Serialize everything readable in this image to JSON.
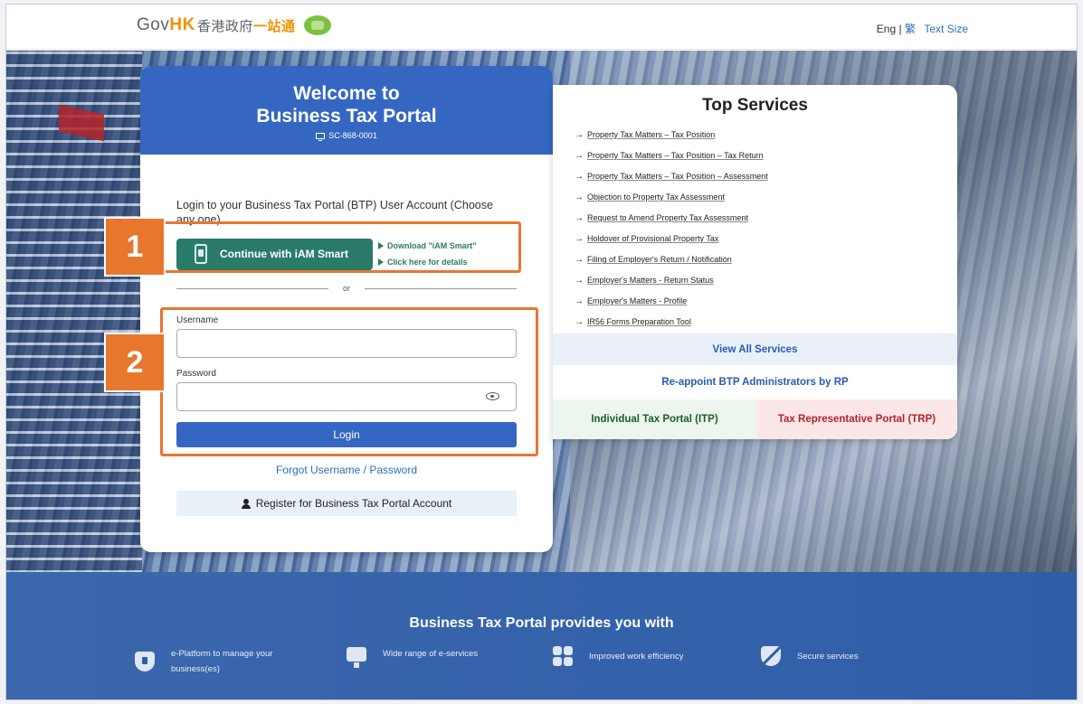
{
  "header": {
    "logo_gov": "Gov",
    "logo_hk": "HK",
    "logo_cn": "香港政府",
    "logo_cn2": "一站通",
    "lang_eng": "Eng |",
    "lang_tc": "繁",
    "text_size": "Text Size"
  },
  "login": {
    "title_line1": "Welcome to",
    "title_line2": "Business Tax Portal",
    "screen_code": "SC-868-0001",
    "prompt": "Login to your Business Tax Portal (BTP) User Account (Choose any one)",
    "iam_button": "Continue with iAM Smart",
    "download_link": "Download \"iAM Smart\"",
    "details_link": "Click here for details",
    "or_text": "or",
    "username_label": "Username",
    "username_value": "",
    "password_label": "Password",
    "password_value": "",
    "login_button": "Login",
    "forgot_link": "Forgot Username / Password",
    "register_button": "Register for Business Tax Portal Account"
  },
  "callouts": [
    "1",
    "2"
  ],
  "services": {
    "title": "Top Services",
    "items": [
      "Property Tax Matters – Tax Position",
      "Property Tax Matters – Tax Position – Tax Return",
      "Property Tax Matters – Tax Position – Assessment",
      "Objection to Property Tax Assessment",
      "Request to Amend Property Tax Assessment",
      "Holdover of Provisional Property Tax",
      "Filing of Employer's Return / Notification",
      "Employer's Matters - Return Status",
      "Employer's Matters - Profile",
      "IR56 Forms Preparation Tool"
    ],
    "view_all": "View All Services",
    "reappoint": "Re-appoint BTP Administrators by RP",
    "itp": "Individual Tax Portal (ITP)",
    "trp": "Tax Representative Portal (TRP)"
  },
  "features": {
    "title": "Business Tax Portal provides you with",
    "items": [
      {
        "icon": "shield-icon",
        "text": "e-Platform to manage your business(es)"
      },
      {
        "icon": "monitor-icon",
        "text": "Wide range of e-services"
      },
      {
        "icon": "grid-icon",
        "text": "Improved work efficiency"
      },
      {
        "icon": "secure-icon",
        "text": "Secure services"
      }
    ]
  },
  "colors": {
    "brand_blue": "#3567c2",
    "iam_green": "#2b7b6a",
    "callout_orange": "#e8772e"
  }
}
